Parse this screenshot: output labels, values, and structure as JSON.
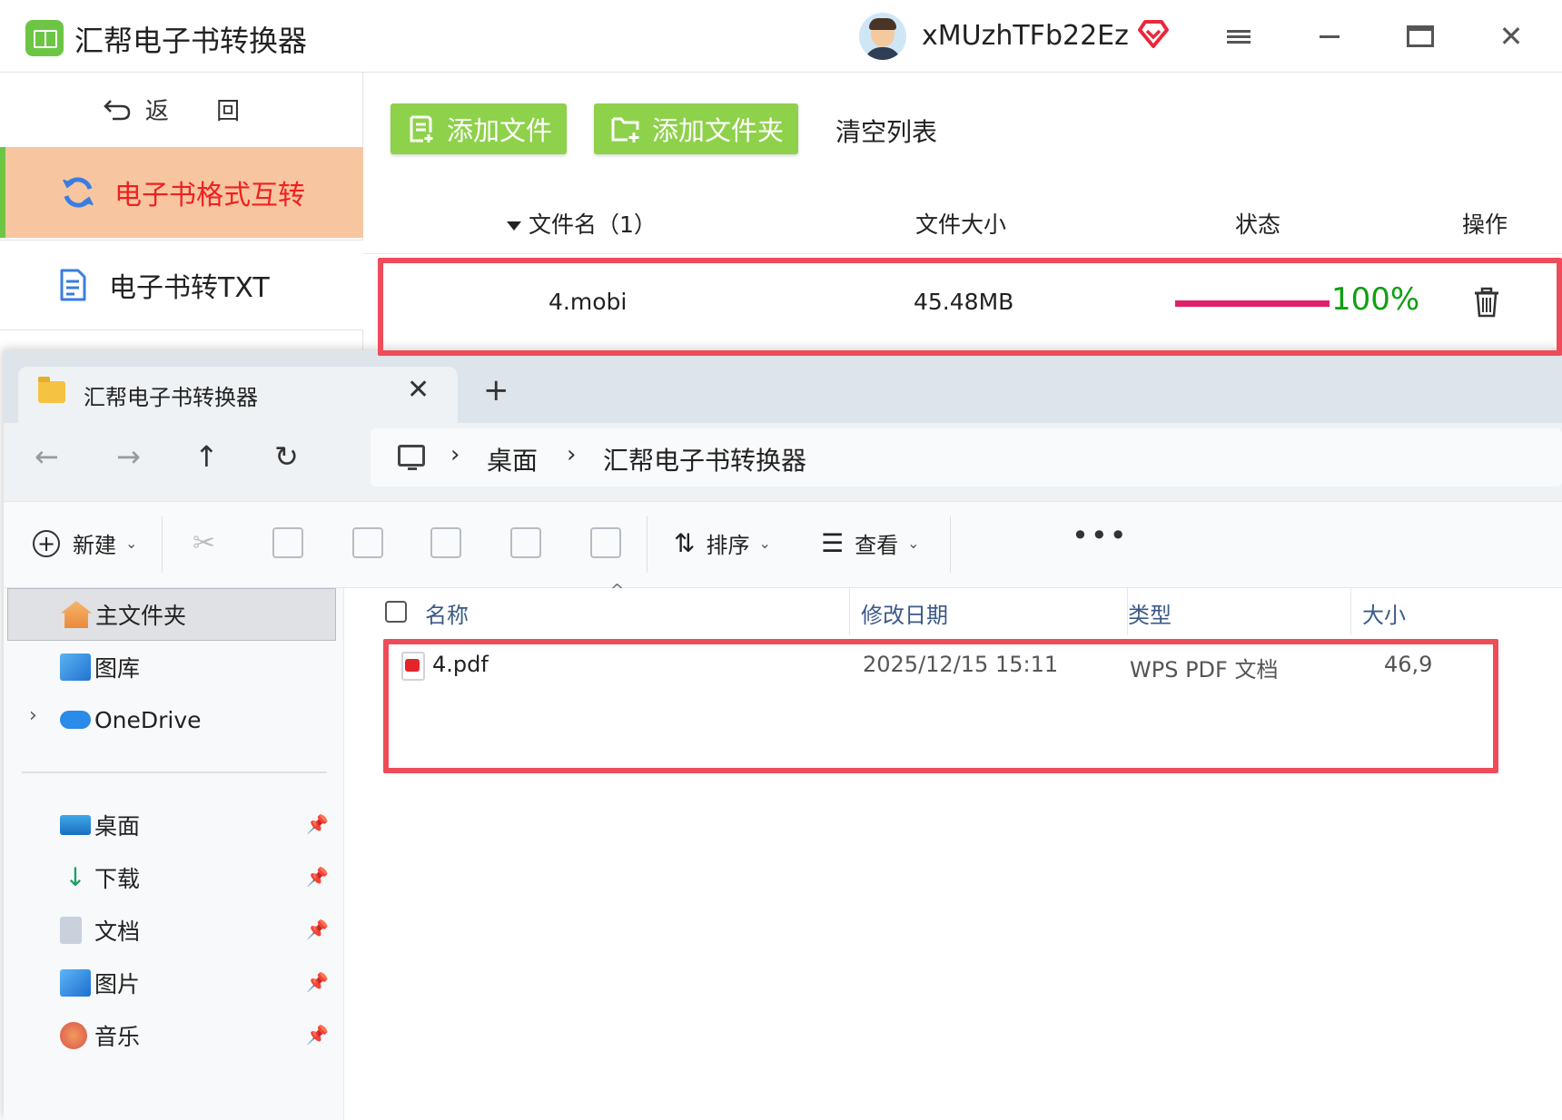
{
  "app": {
    "title": "汇帮电子书转换器",
    "username": "xMUzhTFb22Ez",
    "back_label": "返 回",
    "nav": [
      {
        "label": "电子书格式互转",
        "active": true
      },
      {
        "label": "电子书转TXT",
        "active": false
      }
    ],
    "toolbar": {
      "add_file": "添加文件",
      "add_folder": "添加文件夹",
      "clear_list": "清空列表"
    },
    "table": {
      "headers": {
        "filename": "文件名（1）",
        "size": "文件大小",
        "status": "状态",
        "action": "操作"
      },
      "rows": [
        {
          "name": "4.mobi",
          "size": "45.48MB",
          "progress": 100,
          "progress_label": "100%"
        }
      ]
    },
    "colors": {
      "accent_green": "#8ed14a",
      "active_nav_bg": "#f7c6a1",
      "active_nav_text": "#f02020",
      "progress_bar": "#e0206a",
      "progress_text": "#10a010",
      "highlight": "#ef4c5a"
    }
  },
  "explorer": {
    "tab_title": "汇帮电子书转换器",
    "breadcrumb": [
      "桌面",
      "汇帮电子书转换器"
    ],
    "commands": {
      "new": "新建",
      "sort": "排序",
      "view": "查看"
    },
    "nav_pane": {
      "home": "主文件夹",
      "gallery": "图库",
      "onedrive": "OneDrive",
      "quick_access": [
        "桌面",
        "下载",
        "文档",
        "图片",
        "音乐"
      ]
    },
    "columns": {
      "name": "名称",
      "modified": "修改日期",
      "type": "类型",
      "size": "大小"
    },
    "files": [
      {
        "name": "4.pdf",
        "modified": "2025/12/15 15:11",
        "type": "WPS PDF 文档",
        "size": "46,9"
      }
    ]
  }
}
